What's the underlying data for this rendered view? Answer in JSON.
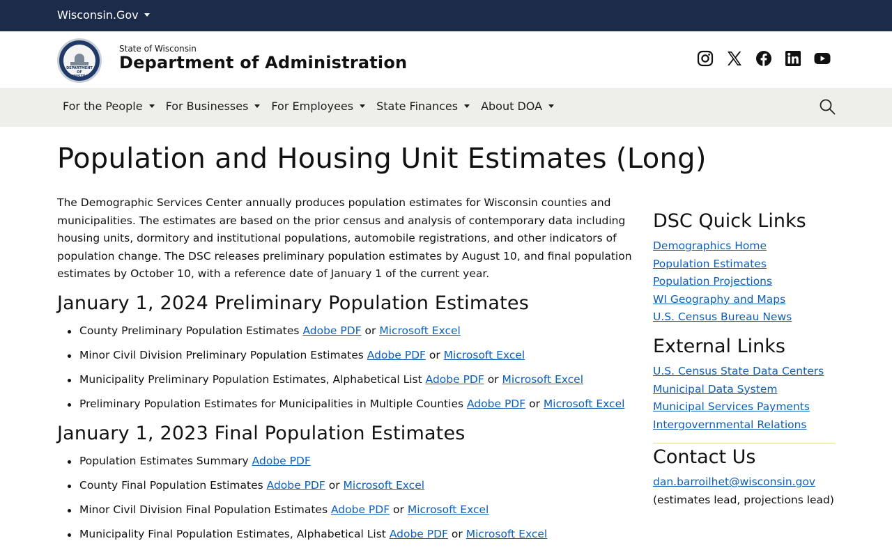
{
  "topbar": {
    "brand": "Wisconsin.Gov"
  },
  "header": {
    "state": "State of Wisconsin",
    "department": "Department of Administration",
    "seal_text": "DEPARTMENT OF ADMINISTRATION",
    "socials": [
      "instagram-icon",
      "x-icon",
      "facebook-icon",
      "linkedin-icon",
      "youtube-icon"
    ]
  },
  "nav": {
    "items": [
      {
        "label": "For the People"
      },
      {
        "label": "For Businesses"
      },
      {
        "label": "For Employees"
      },
      {
        "label": "State Finances"
      },
      {
        "label": "About DOA"
      }
    ]
  },
  "page": {
    "title": "Population and Housing Unit Estimates (Long)",
    "intro": "The Demographic Services Center annually produces population estimates for Wisconsin counties and municipalities. The estimates are based on the prior census and analysis of contemporary data including housing units, dormitory and institutional populations, automobile registrations, and other indicators of population change. The DSC releases preliminary population estimates by August 10, and final population estimates by October 10, with a reference date of January 1 of the current year.",
    "sections": [
      {
        "heading": "January 1, 2024 Preliminary Population Estimates",
        "items": [
          {
            "text": "County Preliminary Population Estimates",
            "link1": "Adobe PDF",
            "sep": "or",
            "link2": "Microsoft Excel"
          },
          {
            "text": "Minor Civil Division Preliminary Population Estimates",
            "link1": "Adobe PDF",
            "sep": "or",
            "link2": "Microsoft Excel"
          },
          {
            "text": "Municipality Preliminary Population Estimates, Alphabetical List",
            "link1": "Adobe PDF",
            "sep": "or",
            "link2": "Microsoft Excel"
          },
          {
            "text": "Preliminary Population Estimates for Municipalities in Multiple Counties",
            "link1": "Adobe PDF",
            "sep": "or",
            "link2": "Microsoft Excel"
          }
        ]
      },
      {
        "heading": "January 1, 2023 Final Population Estimates",
        "items": [
          {
            "text": "Population Estimates Summary",
            "link1": "Adobe PDF"
          },
          {
            "text": "County Final Population Estimates",
            "link1": "Adobe PDF",
            "sep": "or",
            "link2": "Microsoft Excel"
          },
          {
            "text": "Minor Civil Division Final Population Estimates",
            "link1": "Adobe PDF",
            "sep": "or",
            "link2": "Microsoft Excel"
          },
          {
            "text": "Municipality Final Population Estimates, Alphabetical List",
            "link1": "Adobe PDF",
            "sep": "or",
            "link2": "Microsoft Excel"
          }
        ]
      }
    ]
  },
  "sidebar": {
    "quick_links": {
      "heading": "DSC Quick Links",
      "links": [
        "Demographics Home",
        "Population Estimates",
        "Population Projections",
        "WI Geography and Maps",
        "U.S. Census Bureau News"
      ]
    },
    "external_links": {
      "heading": "External Links",
      "links": [
        "U.S. Census State Data Centers",
        "Municipal Data System",
        "Municipal Services Payments",
        "Intergovernmental Relations"
      ]
    },
    "contact": {
      "heading": "Contact Us",
      "email": "dan.barroilhet@wisconsin.gov",
      "note": "(estimates lead, projections lead)"
    }
  },
  "colors": {
    "topbar": "#1c2b4a",
    "navbar": "#eeeeea",
    "link": "#0d5fb8"
  }
}
